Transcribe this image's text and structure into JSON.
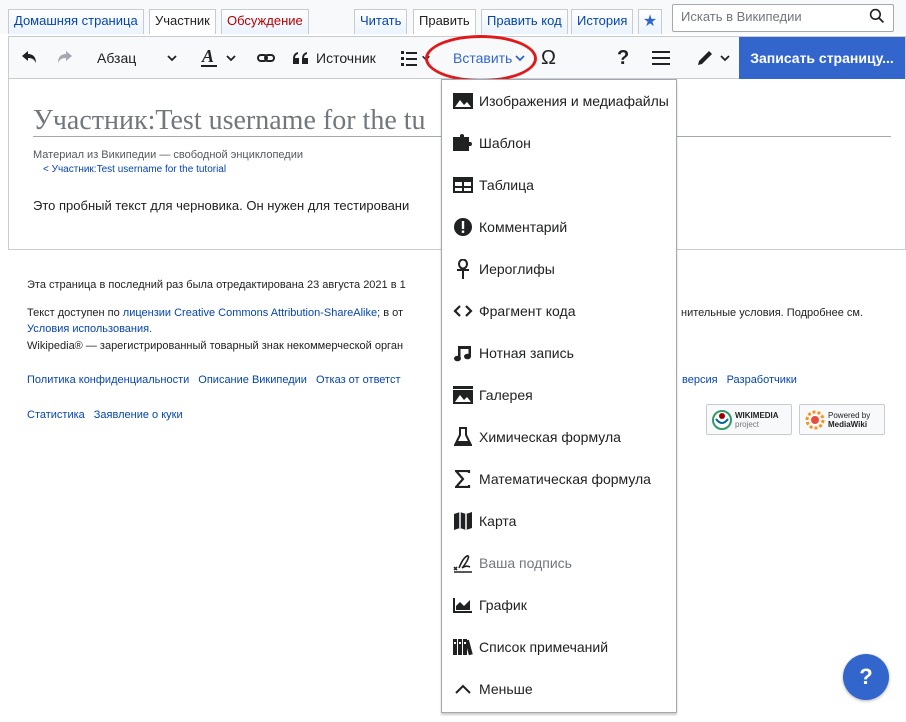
{
  "tabs": {
    "home": "Домашняя страница",
    "user": "Участник",
    "talk": "Обсуждение",
    "read": "Читать",
    "edit": "Править",
    "edit_source": "Править код",
    "history": "История"
  },
  "search": {
    "placeholder": "Искать в Википедии"
  },
  "toolbar": {
    "paragraph": "Абзац",
    "cite": "Источник",
    "insert": "Вставить",
    "save": "Записать страницу..."
  },
  "content": {
    "title": "Участник:Test username for the tu",
    "tagline": "Материал из Википедии — свободной энциклопедии",
    "subpage": "< Участник:Test username for the tutorial",
    "body": "Это пробный текст для черновика. Он нужен для тестировани"
  },
  "footer": {
    "last_edit": "Эта страница в последний раз была отредактирована 23 августа 2021 в 1",
    "license_prefix": "Текст доступен по ",
    "license_link": "лицензии Creative Commons Attribution-ShareAlike",
    "license_suffix": "; в от",
    "license_right": "нительные условия. Подробнее см.",
    "terms": "Условия использования.",
    "trademark": "Wikipedia® — зарегистрированный товарный знак некоммерческой орган",
    "links_left": [
      "Политика конфиденциальности",
      "Описание Википедии",
      "Отказ от ответст"
    ],
    "links_right": [
      "версия",
      "Разработчики"
    ],
    "links_row2": [
      "Статистика",
      "Заявление о куки"
    ],
    "badge_wikimedia": "WIKIMEDIA",
    "badge_wikimedia_sub": "project",
    "badge_powered": "Powered by",
    "badge_mediawiki": "MediaWiki"
  },
  "insert_menu": {
    "items": [
      {
        "label": "Изображения и медиафайлы",
        "icon": "image-icon"
      },
      {
        "label": "Шаблон",
        "icon": "puzzle-icon"
      },
      {
        "label": "Таблица",
        "icon": "table-icon"
      },
      {
        "label": "Комментарий",
        "icon": "alert-icon"
      },
      {
        "label": "Иероглифы",
        "icon": "ankh-icon"
      },
      {
        "label": "Фрагмент кода",
        "icon": "code-icon"
      },
      {
        "label": "Нотная запись",
        "icon": "music-icon"
      },
      {
        "label": "Галерея",
        "icon": "gallery-icon"
      },
      {
        "label": "Химическая формула",
        "icon": "flask-icon"
      },
      {
        "label": "Математическая формула",
        "icon": "sigma-icon"
      },
      {
        "label": "Карта",
        "icon": "map-icon"
      },
      {
        "label": "Ваша подпись",
        "icon": "signature-icon"
      },
      {
        "label": "График",
        "icon": "chart-icon"
      },
      {
        "label": "Список примечаний",
        "icon": "references-icon"
      },
      {
        "label": "Меньше",
        "icon": "collapse-icon"
      }
    ]
  },
  "help": {
    "label": "?"
  },
  "colors": {
    "accent": "#3366cc",
    "link": "#0645ad",
    "highlight": "#e01a1a"
  }
}
